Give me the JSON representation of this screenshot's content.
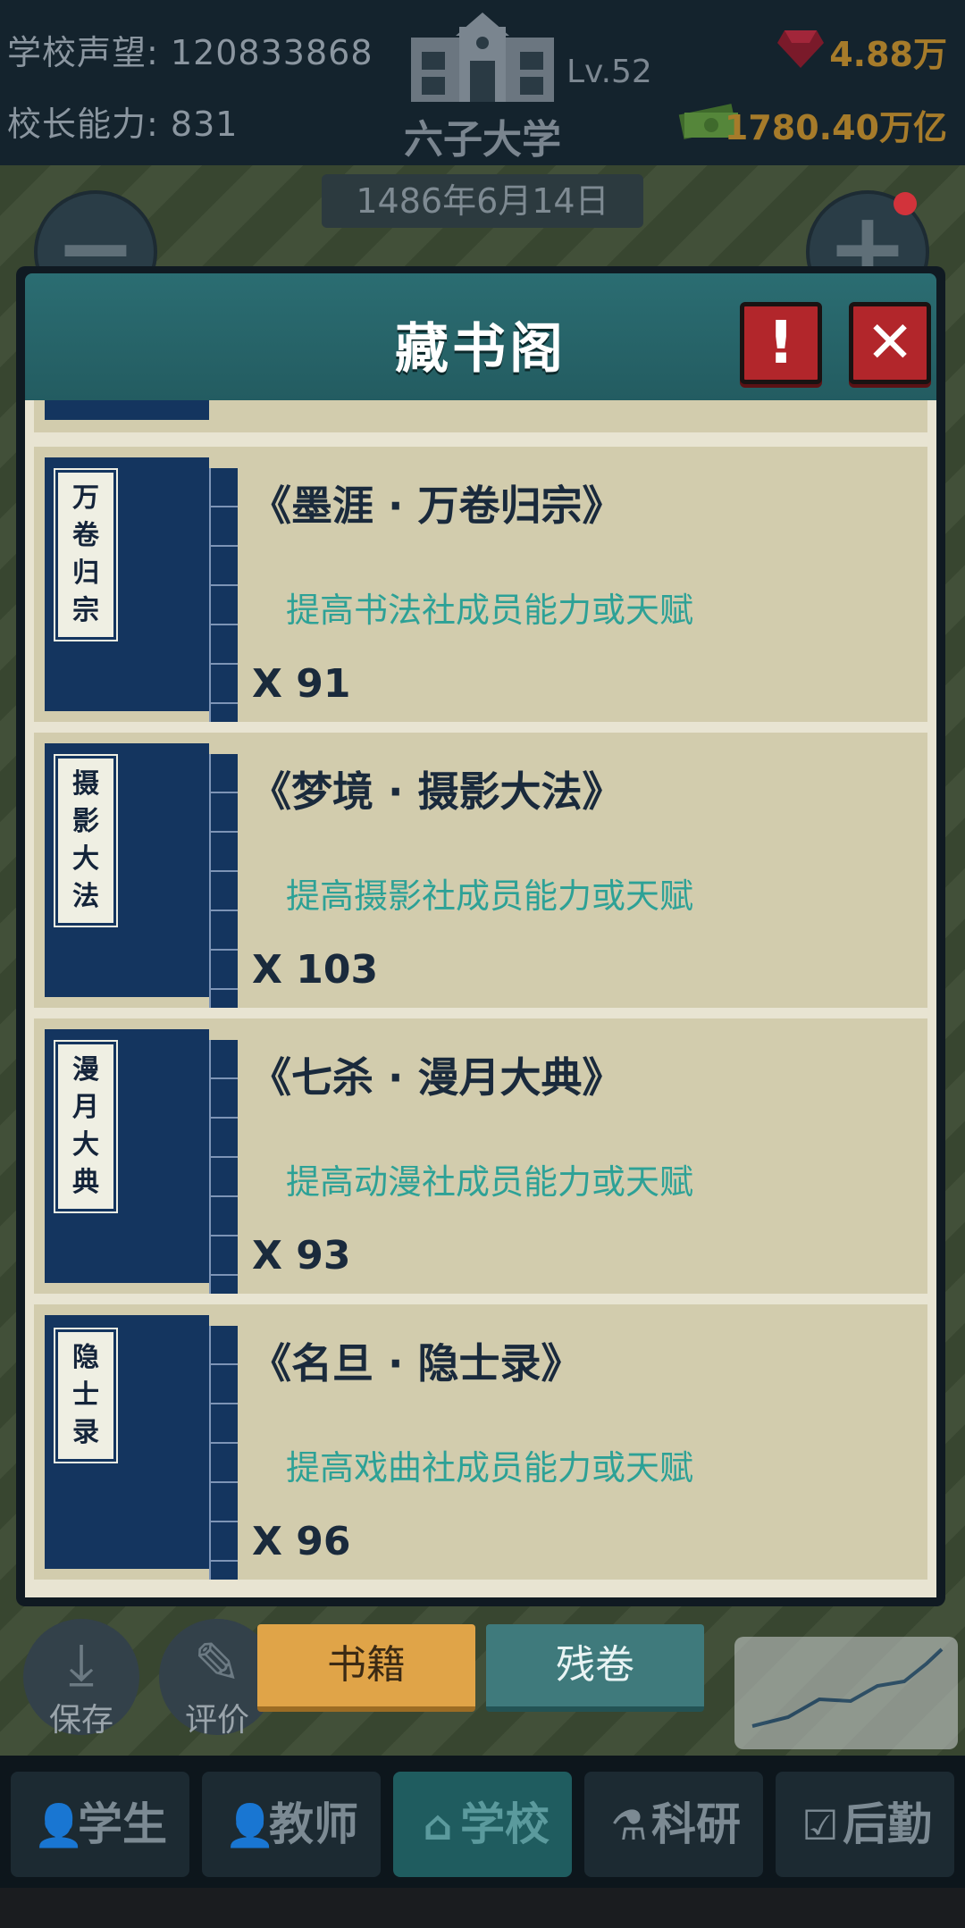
{
  "hud": {
    "prestige_label": "学校声望:",
    "prestige_value": "120833868",
    "ability_label": "校长能力:",
    "ability_value": "831",
    "level": "Lv.52",
    "school_name": "六子大学",
    "gems": "4.88万",
    "money": "1780.40万亿"
  },
  "world": {
    "date": "1486年6月14日",
    "zoom_out": "−",
    "zoom_in": "+"
  },
  "modal": {
    "title": "藏书阁",
    "warn_label": "!",
    "close_label": "✕",
    "books": [
      {
        "spine": [
          "万",
          "卷",
          "归",
          "宗"
        ],
        "title": "《墨涯 · 万卷归宗》",
        "desc": "提高书法社成员能力或天赋",
        "count": "X 91"
      },
      {
        "spine": [
          "摄",
          "影",
          "大",
          "法"
        ],
        "title": "《梦境 · 摄影大法》",
        "desc": "提高摄影社成员能力或天赋",
        "count": "X 103"
      },
      {
        "spine": [
          "漫",
          "月",
          "大",
          "典"
        ],
        "title": "《七杀 · 漫月大典》",
        "desc": "提高动漫社成员能力或天赋",
        "count": "X 93"
      },
      {
        "spine": [
          "隐",
          "士",
          "录"
        ],
        "title": "《名旦 · 隐士录》",
        "desc": "提高戏曲社成员能力或天赋",
        "count": "X 96"
      }
    ]
  },
  "tabs": {
    "books": "书籍",
    "fragments": "残卷"
  },
  "actions": {
    "save": "保存",
    "rate": "评价"
  },
  "nav": {
    "students": "学生",
    "teachers": "教师",
    "school": "学校",
    "research": "科研",
    "logistics": "后勤"
  },
  "colors": {
    "accent_teal": "#2da196",
    "spine_navy": "#14355f",
    "active_tab": "#e0a448"
  }
}
